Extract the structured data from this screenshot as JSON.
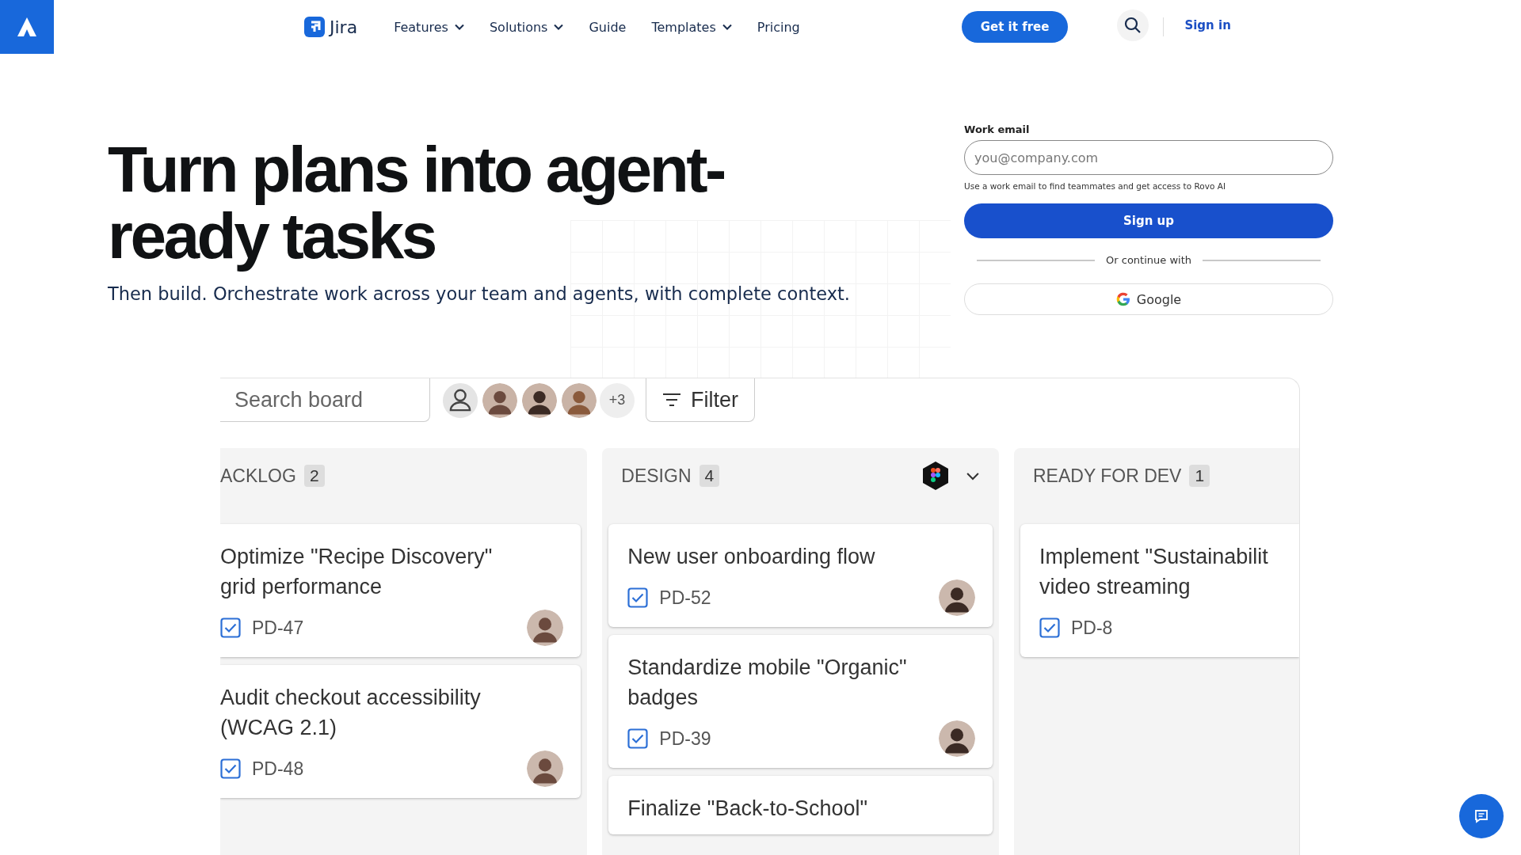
{
  "header": {
    "product": "Jira",
    "nav": [
      {
        "label": "Features",
        "dropdown": true
      },
      {
        "label": "Solutions",
        "dropdown": true
      },
      {
        "label": "Guide",
        "dropdown": false
      },
      {
        "label": "Templates",
        "dropdown": true
      },
      {
        "label": "Pricing",
        "dropdown": false
      }
    ],
    "cta": "Get it free",
    "sign_in": "Sign in"
  },
  "hero": {
    "title_lines": [
      "Turn plans into agent-",
      "ready tasks"
    ],
    "subtitle": "Then build. Orchestrate work across your team and agents, with complete context."
  },
  "signup": {
    "label": "Work email",
    "placeholder": "you@company.com",
    "helper": "Use a work email to find teammates and get access to Rovo AI",
    "submit": "Sign up",
    "divider": "Or continue with",
    "google": "Google"
  },
  "board": {
    "search": {
      "placeholder": "Search board"
    },
    "members": [
      {
        "kind": "placeholder"
      },
      {
        "kind": "photo"
      },
      {
        "kind": "photo"
      },
      {
        "kind": "photo"
      }
    ],
    "more_members": "+3",
    "filter": "Filter",
    "columns": [
      {
        "name": "ACKLOG",
        "count": "2",
        "app_menu": false,
        "cards": [
          {
            "title": "Optimize \"Recipe Discovery\"\ngrid performance",
            "key": "PD-47",
            "assignee": true
          },
          {
            "title": "Audit checkout accessibility\n(WCAG 2.1)",
            "key": "PD-48",
            "assignee": true
          }
        ]
      },
      {
        "name": "DESIGN",
        "count": "4",
        "app_menu": true,
        "cards": [
          {
            "title": "New user onboarding flow",
            "key": "PD-52",
            "assignee": true
          },
          {
            "title": "Standardize mobile \"Organic\"\nbadges",
            "key": "PD-39",
            "assignee": true
          },
          {
            "title": "Finalize \"Back-to-School\"",
            "assignee": false
          }
        ]
      },
      {
        "name": "READY FOR DEV",
        "count": "1",
        "app_menu": false,
        "cards": [
          {
            "title": "Implement \"Sustainabilit\nvideo streaming",
            "key": "PD-8",
            "assignee": false
          }
        ]
      }
    ]
  }
}
